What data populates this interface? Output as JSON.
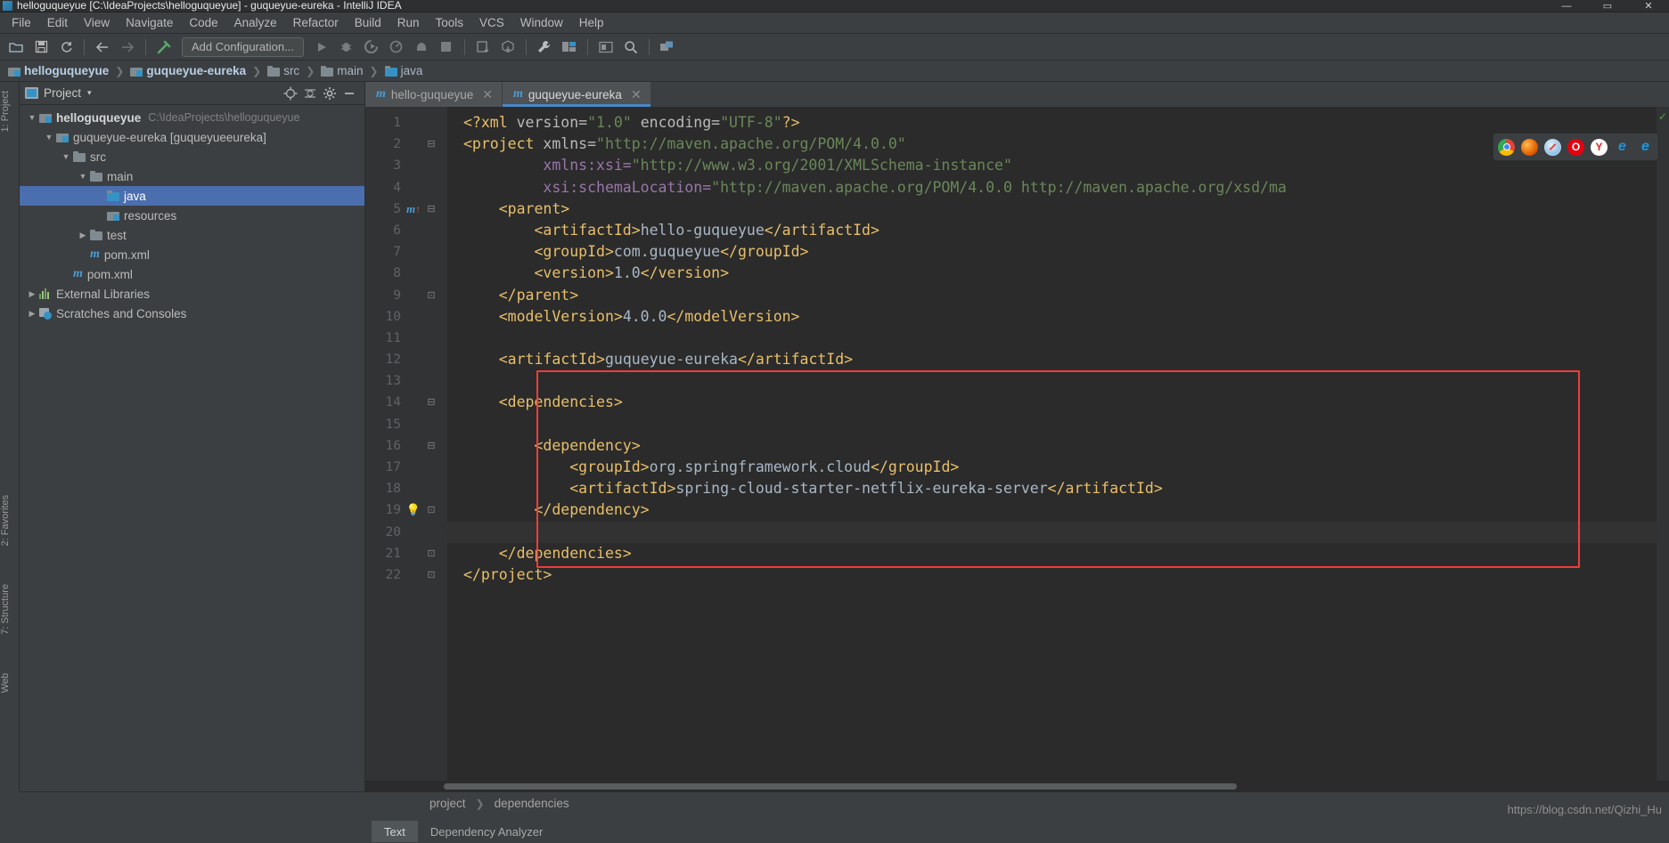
{
  "window": {
    "title": "helloguqueyue [C:\\IdeaProjects\\helloguqueyue] - guqueyue-eureka - IntelliJ IDEA",
    "minimize": "—",
    "maximize": "▭",
    "close": "✕"
  },
  "menubar": {
    "items": [
      {
        "label": "File"
      },
      {
        "label": "Edit"
      },
      {
        "label": "View"
      },
      {
        "label": "Navigate"
      },
      {
        "label": "Code"
      },
      {
        "label": "Analyze"
      },
      {
        "label": "Refactor"
      },
      {
        "label": "Build"
      },
      {
        "label": "Run"
      },
      {
        "label": "Tools"
      },
      {
        "label": "VCS"
      },
      {
        "label": "Window"
      },
      {
        "label": "Help"
      }
    ]
  },
  "toolbar": {
    "add_configuration": "Add Configuration...",
    "icons": [
      "open-folder-icon",
      "save-all-icon",
      "sync-refresh-icon",
      "back-arrow-icon",
      "forward-arrow-icon",
      "build-hammer-icon",
      "run-icon",
      "debug-icon",
      "run-coverage-icon",
      "profiler-icon",
      "stop-dumb-icon",
      "stop-icon",
      "update-project-icon",
      "commit-icon",
      "settings-wrench-icon",
      "project-structure-icon",
      "sdk-icon",
      "search-everywhere-icon",
      "ui-designer-icon"
    ]
  },
  "navbar": {
    "crumbs": [
      {
        "label": "helloguqueyue",
        "icon": "module-folder-icon",
        "bold": true
      },
      {
        "label": "guqueyue-eureka",
        "icon": "module-folder-icon",
        "bold": true
      },
      {
        "label": "src",
        "icon": "folder-icon",
        "bold": false
      },
      {
        "label": "main",
        "icon": "folder-icon",
        "bold": false
      },
      {
        "label": "java",
        "icon": "source-folder-icon",
        "bold": false
      }
    ],
    "separator": "❯"
  },
  "project_panel": {
    "title": "Project",
    "caret": "▾",
    "header_icons": [
      "locate-target-icon",
      "collapse-all-icon",
      "gear-icon",
      "hide-icon"
    ],
    "tree": [
      {
        "label": "helloguqueyue",
        "sub": "C:\\IdeaProjects\\helloguqueyue",
        "indent": 0,
        "arrow": "▼",
        "icon": "module-folder-icon",
        "bold": true,
        "selected": false
      },
      {
        "label": "guqueyue-eureka [guqueyueeureka]",
        "sub": "",
        "indent": 1,
        "arrow": "▼",
        "icon": "module-folder-icon",
        "bold": false,
        "selected": false
      },
      {
        "label": "src",
        "sub": "",
        "indent": 2,
        "arrow": "▼",
        "icon": "folder-icon",
        "bold": false,
        "selected": false
      },
      {
        "label": "main",
        "sub": "",
        "indent": 3,
        "arrow": "▼",
        "icon": "folder-icon",
        "bold": false,
        "selected": false
      },
      {
        "label": "java",
        "sub": "",
        "indent": 4,
        "arrow": "",
        "icon": "source-folder-icon",
        "bold": false,
        "selected": true
      },
      {
        "label": "resources",
        "sub": "",
        "indent": 4,
        "arrow": "",
        "icon": "resources-folder-icon",
        "bold": false,
        "selected": false
      },
      {
        "label": "test",
        "sub": "",
        "indent": 3,
        "arrow": "▶",
        "icon": "folder-icon",
        "bold": false,
        "selected": false
      },
      {
        "label": "pom.xml",
        "sub": "",
        "indent": 3,
        "arrow": "",
        "icon": "maven-file-icon",
        "bold": false,
        "selected": false
      },
      {
        "label": "pom.xml",
        "sub": "",
        "indent": 2,
        "arrow": "",
        "icon": "maven-file-icon",
        "bold": false,
        "selected": false
      },
      {
        "label": "External Libraries",
        "sub": "",
        "indent": 0,
        "arrow": "▶",
        "icon": "libraries-icon",
        "bold": false,
        "selected": false
      },
      {
        "label": "Scratches and Consoles",
        "sub": "",
        "indent": 0,
        "arrow": "▶",
        "icon": "scratches-icon",
        "bold": false,
        "selected": false
      }
    ]
  },
  "left_strip": {
    "buttons": [
      "2: Favorites",
      "7: Structure",
      "Web"
    ]
  },
  "editor": {
    "tabs": [
      {
        "label": "hello-guqueyue",
        "icon": "maven-file-icon",
        "close": "✕",
        "active": false
      },
      {
        "label": "guqueyue-eureka",
        "icon": "maven-file-icon",
        "close": "✕",
        "active": true
      }
    ],
    "current_line": 20,
    "lines": [
      {
        "n": 1,
        "fold": "",
        "marker": "",
        "segs": [
          {
            "t": "pi",
            "s": "<?xml "
          },
          {
            "t": "attr",
            "s": "version="
          },
          {
            "t": "val",
            "s": "\"1.0\""
          },
          {
            "t": "attr",
            "s": " encoding="
          },
          {
            "t": "val",
            "s": "\"UTF-8\""
          },
          {
            "t": "pi",
            "s": "?>"
          }
        ],
        "indent": 0
      },
      {
        "n": 2,
        "fold": "⊟",
        "marker": "",
        "segs": [
          {
            "t": "tag",
            "s": "<project "
          },
          {
            "t": "attr",
            "s": "xmlns="
          },
          {
            "t": "val",
            "s": "\"http://maven.apache.org/POM/4.0.0\""
          }
        ],
        "indent": 0
      },
      {
        "n": 3,
        "fold": "",
        "marker": "",
        "segs": [
          {
            "t": "ns",
            "s": "         xmlns:xsi="
          },
          {
            "t": "val",
            "s": "\"http://www.w3.org/2001/XMLSchema-instance\""
          }
        ],
        "indent": 0
      },
      {
        "n": 4,
        "fold": "",
        "marker": "",
        "segs": [
          {
            "t": "ns",
            "s": "         xsi:schemaLocation="
          },
          {
            "t": "val",
            "s": "\"http://maven.apache.org/POM/4.0.0 http://maven.apache.org/xsd/ma"
          }
        ],
        "indent": 0
      },
      {
        "n": 5,
        "fold": "⊟",
        "marker": "m↑",
        "segs": [
          {
            "t": "tag",
            "s": "    <parent>"
          }
        ],
        "indent": 0
      },
      {
        "n": 6,
        "fold": "",
        "marker": "",
        "segs": [
          {
            "t": "tag",
            "s": "        <artifactId>"
          },
          {
            "t": "txt",
            "s": "hello-guqueyue"
          },
          {
            "t": "tag",
            "s": "</artifactId>"
          }
        ],
        "indent": 0
      },
      {
        "n": 7,
        "fold": "",
        "marker": "",
        "segs": [
          {
            "t": "tag",
            "s": "        <groupId>"
          },
          {
            "t": "txt",
            "s": "com.guqueyue"
          },
          {
            "t": "tag",
            "s": "</groupId>"
          }
        ],
        "indent": 0
      },
      {
        "n": 8,
        "fold": "",
        "marker": "",
        "segs": [
          {
            "t": "tag",
            "s": "        <version>"
          },
          {
            "t": "txt",
            "s": "1.0"
          },
          {
            "t": "tag",
            "s": "</version>"
          }
        ],
        "indent": 0
      },
      {
        "n": 9,
        "fold": "⊡",
        "marker": "",
        "segs": [
          {
            "t": "tag",
            "s": "    </parent>"
          }
        ],
        "indent": 0
      },
      {
        "n": 10,
        "fold": "",
        "marker": "",
        "segs": [
          {
            "t": "tag",
            "s": "    <modelVersion>"
          },
          {
            "t": "txt",
            "s": "4.0.0"
          },
          {
            "t": "tag",
            "s": "</modelVersion>"
          }
        ],
        "indent": 0
      },
      {
        "n": 11,
        "fold": "",
        "marker": "",
        "segs": [
          {
            "t": "txt",
            "s": ""
          }
        ],
        "indent": 0
      },
      {
        "n": 12,
        "fold": "",
        "marker": "",
        "segs": [
          {
            "t": "tag",
            "s": "    <artifactId>"
          },
          {
            "t": "txt",
            "s": "guqueyue-eureka"
          },
          {
            "t": "tag",
            "s": "</artifactId>"
          }
        ],
        "indent": 0
      },
      {
        "n": 13,
        "fold": "",
        "marker": "",
        "segs": [
          {
            "t": "txt",
            "s": ""
          }
        ],
        "indent": 0
      },
      {
        "n": 14,
        "fold": "⊟",
        "marker": "",
        "segs": [
          {
            "t": "tag",
            "s": "    <dependencies>"
          }
        ],
        "indent": 0
      },
      {
        "n": 15,
        "fold": "",
        "marker": "",
        "segs": [
          {
            "t": "txt",
            "s": ""
          }
        ],
        "indent": 0
      },
      {
        "n": 16,
        "fold": "⊟",
        "marker": "",
        "segs": [
          {
            "t": "tag",
            "s": "        <dependency>"
          }
        ],
        "indent": 0
      },
      {
        "n": 17,
        "fold": "",
        "marker": "",
        "segs": [
          {
            "t": "tag",
            "s": "            <groupId>"
          },
          {
            "t": "txt",
            "s": "org.springframework.cloud"
          },
          {
            "t": "tag",
            "s": "</groupId>"
          }
        ],
        "indent": 0
      },
      {
        "n": 18,
        "fold": "",
        "marker": "",
        "segs": [
          {
            "t": "tag",
            "s": "            <artifactId>"
          },
          {
            "t": "txt",
            "s": "spring-cloud-starter-netflix-eureka-server"
          },
          {
            "t": "tag",
            "s": "</artifactId>"
          }
        ],
        "indent": 0
      },
      {
        "n": 19,
        "fold": "⊡",
        "marker": "bulb",
        "segs": [
          {
            "t": "tag",
            "s": "        </dependency>"
          }
        ],
        "indent": 0
      },
      {
        "n": 20,
        "fold": "",
        "marker": "",
        "segs": [
          {
            "t": "txt",
            "s": ""
          }
        ],
        "indent": 0
      },
      {
        "n": 21,
        "fold": "⊡",
        "marker": "",
        "segs": [
          {
            "t": "tag",
            "s": "    </dependencies>"
          }
        ],
        "indent": 0
      },
      {
        "n": 22,
        "fold": "⊡",
        "marker": "",
        "segs": [
          {
            "t": "tag",
            "s": "</project>"
          }
        ],
        "indent": 0
      }
    ],
    "annotation": {
      "color": "#f03c3c",
      "from_line": 13,
      "to_line": 21
    },
    "browser_icons": [
      {
        "name": "chrome-icon",
        "glyph": "",
        "color": "#f4c20d"
      },
      {
        "name": "firefox-icon",
        "glyph": "",
        "color": "#e66000"
      },
      {
        "name": "safari-icon",
        "glyph": "",
        "color": "#3f9fe0"
      },
      {
        "name": "opera-icon",
        "glyph": "O",
        "color": "#e2010f"
      },
      {
        "name": "yandex-icon",
        "glyph": "Y",
        "color": "#ffffff"
      },
      {
        "name": "ie-icon",
        "glyph": "e",
        "color": "#2a8fd4"
      },
      {
        "name": "edge-icon",
        "glyph": "e",
        "color": "#1a9ae0"
      }
    ]
  },
  "bottom": {
    "breadcrumb": [
      {
        "label": "project"
      },
      {
        "label": "dependencies"
      }
    ],
    "separator": "❯",
    "tabs": [
      {
        "label": "Text",
        "active": true
      },
      {
        "label": "Dependency Analyzer",
        "active": false
      }
    ],
    "watermark": "https://blog.csdn.net/Qizhi_Hu"
  }
}
